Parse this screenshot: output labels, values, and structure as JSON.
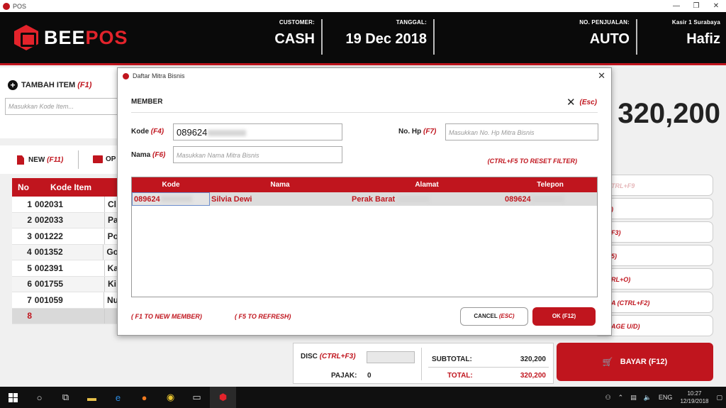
{
  "window": {
    "title": "POS",
    "controls": [
      "—",
      "❐",
      "✕"
    ]
  },
  "header": {
    "logo_main": "BEE",
    "logo_accent": "POS",
    "customer_label": "CUSTOMER:",
    "customer_value": "CASH",
    "date_label": "TANGGAL:",
    "date_value": "19 Dec 2018",
    "sale_no_label": "NO. PENJUALAN:",
    "sale_no_value": "AUTO",
    "cashier_label": "Kasir 1 Surabaya",
    "cashier_value": "Hafiz"
  },
  "left": {
    "add_item_label": "TAMBAH ITEM",
    "add_item_shortcut": "(F1)",
    "kode_placeholder": "Masukkan Kode Item...",
    "new_label": "NEW",
    "new_shortcut": "(F11)",
    "open_label": "OP"
  },
  "big_total": "320,200",
  "grid": {
    "headers": {
      "no": "No",
      "kode": "Kode Item"
    },
    "rows": [
      {
        "no": "1",
        "kode": "002031",
        "nama": "Cl"
      },
      {
        "no": "2",
        "kode": "002033",
        "nama": "Pa"
      },
      {
        "no": "3",
        "kode": "001222",
        "nama": "Po"
      },
      {
        "no": "4",
        "kode": "001352",
        "nama": "Go"
      },
      {
        "no": "5",
        "kode": "002391",
        "nama": "Ka"
      },
      {
        "no": "6",
        "kode": "001755",
        "nama": "Ki"
      },
      {
        "no": "7",
        "kode": "001059",
        "nama": "Nu"
      },
      {
        "no": "8",
        "kode": "",
        "nama": ""
      }
    ]
  },
  "right_buttons": [
    "TRL+F9",
    ")",
    "F3)",
    "5)",
    "RL+O)",
    "A (CTRL+F2)",
    "AGE U/D)"
  ],
  "summary": {
    "disc_label": "DISC",
    "disc_shortcut": "(CTRL+F3)",
    "pajak_label": "PAJAK:",
    "pajak_value": "0",
    "subtotal_label": "SUBTOTAL:",
    "subtotal_value": "320,200",
    "total_label": "TOTAL:",
    "total_value": "320,200"
  },
  "bayar": {
    "label": "BAYAR (F12)"
  },
  "modal": {
    "title": "Daftar Mitra Bisnis",
    "heading": "MEMBER",
    "close_shortcut": "(Esc)",
    "kode_label": "Kode",
    "kode_shortcut": "(F4)",
    "kode_value": "089624",
    "nama_label": "Nama",
    "nama_shortcut": "(F6)",
    "nama_placeholder": "Masukkan Nama Mitra Bisnis",
    "hp_label": "No. Hp",
    "hp_shortcut": "(F7)",
    "hp_placeholder": "Masukkan No. Hp Mitra Bisnis",
    "reset_hint": "(CTRL+F5 TO RESET FILTER)",
    "columns": [
      "Kode",
      "Nama",
      "Alamat",
      "Telepon"
    ],
    "rows": [
      {
        "kode": "089624",
        "nama": "Silvia Dewi",
        "alamat": "Perak Barat",
        "telepon": "089624"
      }
    ],
    "hint_new": "( F1 TO NEW MEMBER)",
    "hint_refresh": "( F5 TO REFRESH)",
    "cancel_label": "CANCEL",
    "cancel_shortcut": "(ESC)",
    "ok_label": "OK (F12)"
  },
  "taskbar": {
    "lang": "ENG",
    "time": "10:27",
    "date": "12/19/2018"
  },
  "colors": {
    "accent": "#c0151e",
    "header_bg": "#0a0a0a"
  }
}
